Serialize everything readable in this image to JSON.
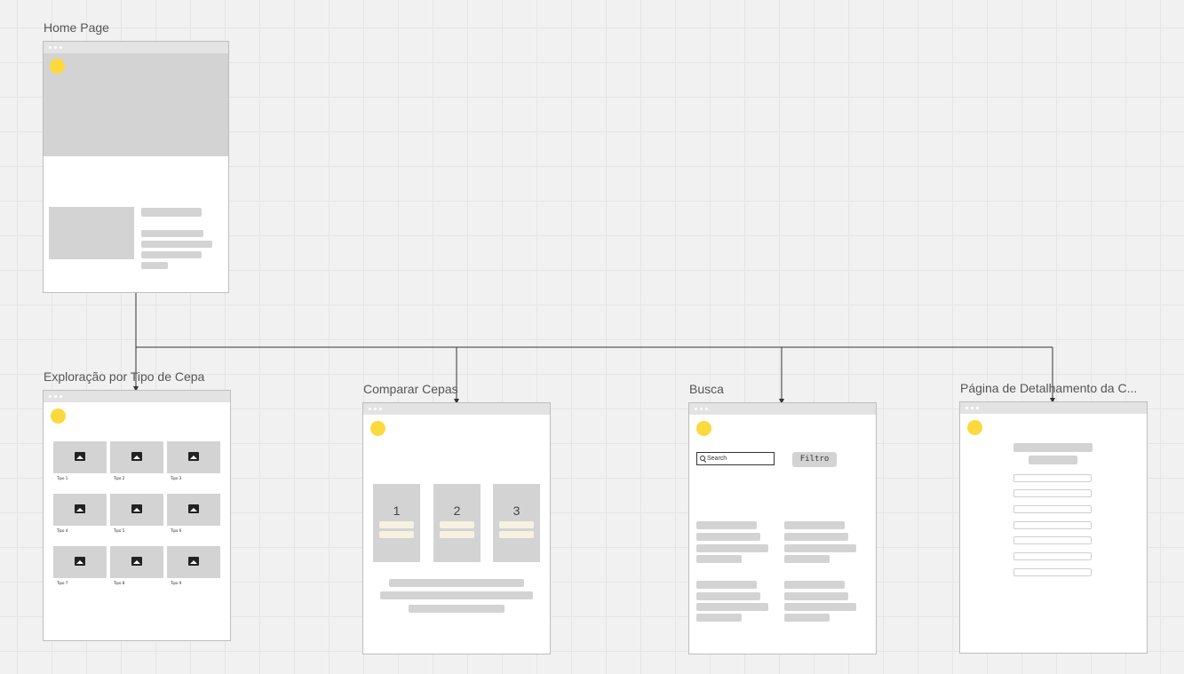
{
  "frames": [
    {
      "id": "home",
      "label": "Home Page"
    },
    {
      "id": "explore",
      "label": "Exploração por Tipo de Cepa",
      "tiles": [
        {
          "caption": "Tipo 1"
        },
        {
          "caption": "Tipo 2"
        },
        {
          "caption": "Tipo 3"
        },
        {
          "caption": "Tipo 4"
        },
        {
          "caption": "Tipo 5"
        },
        {
          "caption": "Tipo 6"
        },
        {
          "caption": "Tipo 7"
        },
        {
          "caption": "Tipo 8"
        },
        {
          "caption": "Tipo 9"
        }
      ]
    },
    {
      "id": "compare",
      "label": "Comparar Cepas",
      "columns": [
        "1",
        "2",
        "3"
      ]
    },
    {
      "id": "search",
      "label": "Busca",
      "search_placeholder": "Search",
      "filter_label": "Filtro"
    },
    {
      "id": "detail",
      "label": "Página de Detalhamento da C..."
    }
  ],
  "colors": {
    "accent_dot": "#fcd93d",
    "placeholder_gray": "#d3d3d3",
    "connector": "#333333",
    "canvas": "#f1f1f1"
  }
}
